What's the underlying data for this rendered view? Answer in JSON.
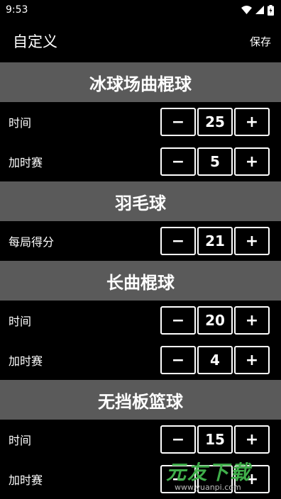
{
  "status": {
    "time": "9:53"
  },
  "appbar": {
    "title": "自定义",
    "save_label": "保存"
  },
  "sections": [
    {
      "title": "冰球场曲棍球",
      "rows": [
        {
          "label": "时间",
          "value": "25"
        },
        {
          "label": "加时赛",
          "value": "5"
        }
      ]
    },
    {
      "title": "羽毛球",
      "rows": [
        {
          "label": "每局得分",
          "value": "21"
        }
      ]
    },
    {
      "title": "长曲棍球",
      "rows": [
        {
          "label": "时间",
          "value": "20"
        },
        {
          "label": "加时赛",
          "value": "4"
        }
      ]
    },
    {
      "title": "无挡板篮球",
      "rows": [
        {
          "label": "时间",
          "value": "15"
        },
        {
          "label": "加时赛",
          "value": ""
        }
      ]
    }
  ],
  "stepper": {
    "minus": "−",
    "plus": "+"
  },
  "watermark": {
    "brand": "元友下载",
    "url": "www.yuanpi.com"
  }
}
